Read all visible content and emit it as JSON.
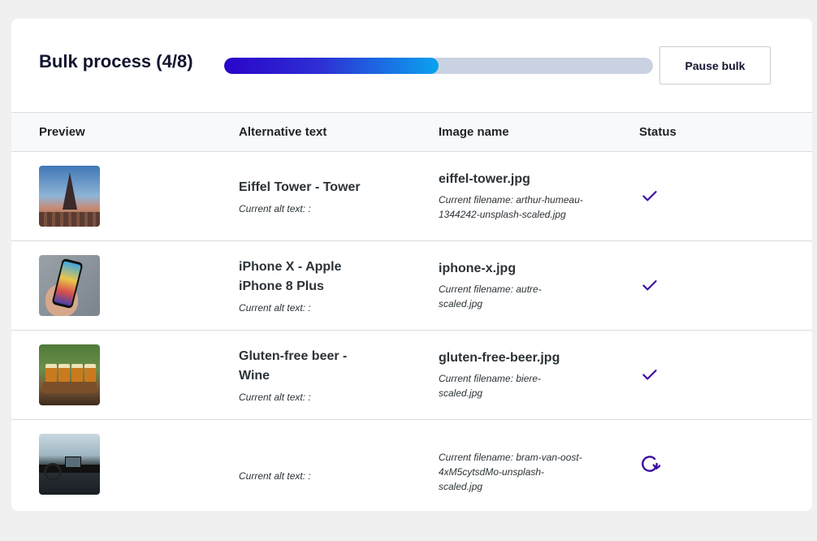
{
  "header": {
    "title": "Bulk process (4/8)",
    "progress": 0.5,
    "pause_label": "Pause bulk"
  },
  "columns": {
    "preview": "Preview",
    "alt": "Alternative text",
    "image": "Image name",
    "status": "Status"
  },
  "rows": [
    {
      "preview_icon": "eiffel-tower-photo",
      "alt_title": "Eiffel Tower - Tower",
      "alt_current": "Current alt text: :",
      "image_name": "eiffel-tower.jpg",
      "current_filename": "Current filename: arthur-humeau-1344242-unsplash-scaled.jpg",
      "status": "done"
    },
    {
      "preview_icon": "iphone-photo",
      "alt_title": "iPhone X - Apple iPhone 8 Plus",
      "alt_current": "Current alt text: :",
      "image_name": "iphone-x.jpg",
      "current_filename": "Current filename: autre-scaled.jpg",
      "status": "done"
    },
    {
      "preview_icon": "beer-photo",
      "alt_title": "Gluten-free beer - Wine",
      "alt_current": "Current alt text: :",
      "image_name": "gluten-free-beer.jpg",
      "current_filename": "Current filename: biere-scaled.jpg",
      "status": "done"
    },
    {
      "preview_icon": "car-interior-photo",
      "alt_title": "",
      "alt_current": "Current alt text: :",
      "image_name": "",
      "current_filename": "Current filename: bram-van-oost-4xM5cytsdMo-unsplash-scaled.jpg",
      "status": "processing"
    }
  ],
  "colors": {
    "accent": "#3a0ca3",
    "progress_start": "#2a04c9",
    "progress_end": "#0aa3ee",
    "progress_track": "#c9d2e1"
  }
}
